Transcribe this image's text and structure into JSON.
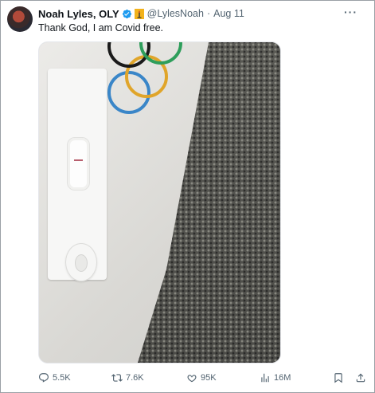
{
  "tweet": {
    "author_name": "Noah Lyles, OLY",
    "handle": "@LylesNoah",
    "separator": "·",
    "date": "Aug 11",
    "text": "Thank God, I am Covid free.",
    "more_label": "···"
  },
  "actions": {
    "replies": "5.5K",
    "reposts": "7.6K",
    "likes": "95K",
    "views": "16M"
  },
  "colors": {
    "text": "#0f1419",
    "muted": "#536471",
    "verified": "#1d9bf0",
    "ring_blue": "#3a86c8",
    "ring_black": "#1a1a1a",
    "ring_green": "#2e9e5b",
    "ring_yellow": "#e0a52a"
  },
  "icons": {
    "verified": "verified-badge-icon",
    "flag": "olympic-torch-icon",
    "more": "more-icon",
    "reply": "reply-icon",
    "repost": "repost-icon",
    "like": "heart-icon",
    "views": "views-chart-icon",
    "bookmark": "bookmark-icon",
    "share": "share-icon"
  }
}
